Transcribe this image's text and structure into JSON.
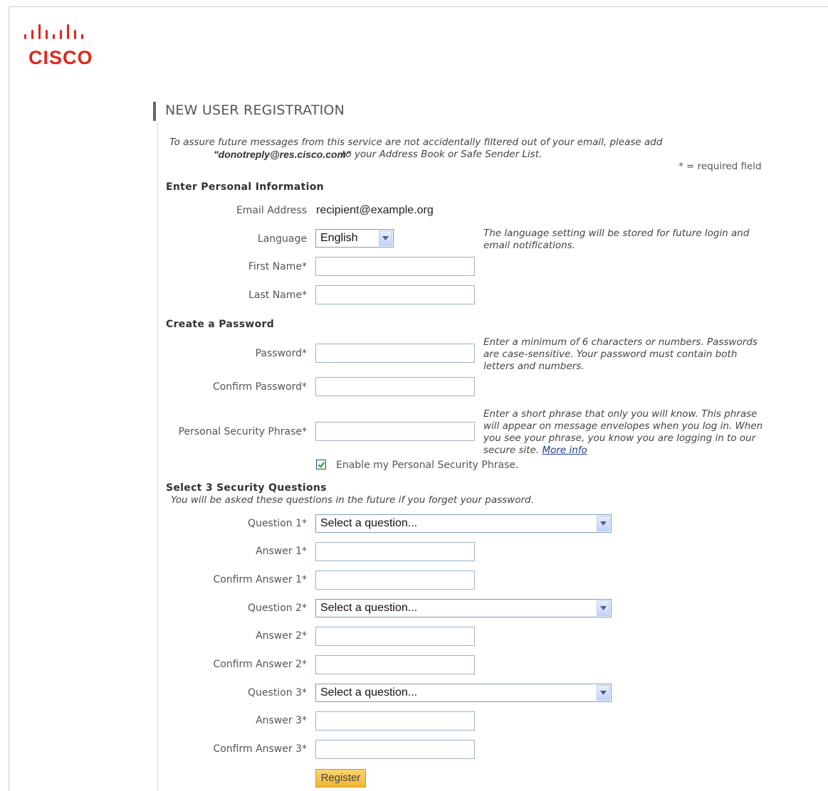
{
  "brand": {
    "name": "CISCO",
    "color": "#e2251b"
  },
  "page": {
    "title": "NEW USER REGISTRATION"
  },
  "notice": {
    "line1": "To assure future messages from this service are not accidentally filtered out of your email, please add",
    "email": "\"donotreply@res.cisco.com\"",
    "line2": "to your Address Book or Safe Sender List.",
    "required": "* = required field"
  },
  "personal": {
    "heading": "Enter Personal Information",
    "email_label": "Email Address",
    "email_value": "recipient@example.org",
    "language_label": "Language",
    "language_value": "English",
    "language_help": "The language setting will be stored for future login and email notifications.",
    "first_name_label": "First Name*",
    "last_name_label": "Last Name*"
  },
  "password": {
    "heading": "Create a Password",
    "password_label": "Password*",
    "password_help": "Enter a minimum of 6 characters or numbers. Passwords are case-sensitive. Your password must contain both letters and numbers.",
    "confirm_label": "Confirm Password*",
    "phrase_label": "Personal Security Phrase*",
    "phrase_help": "Enter a short phrase that only you will know. This phrase will appear on message envelopes when you log in. When you see your phrase, you know you are logging in to our secure site.",
    "more_info": "More info",
    "enable_phrase_label": "Enable my Personal Security Phrase.",
    "enable_phrase_checked": true
  },
  "security": {
    "heading": "Select 3 Security Questions",
    "subheading": "You will be asked these questions in the future if you forget your password.",
    "question1_label": "Question 1*",
    "answer1_label": "Answer 1*",
    "confirm1_label": "Confirm Answer 1*",
    "question2_label": "Question 2*",
    "answer2_label": "Answer 2*",
    "confirm2_label": "Confirm Answer 2*",
    "question3_label": "Question 3*",
    "answer3_label": "Answer 3*",
    "confirm3_label": "Confirm Answer 3*",
    "select_placeholder": "Select a question..."
  },
  "actions": {
    "register": "Register"
  }
}
